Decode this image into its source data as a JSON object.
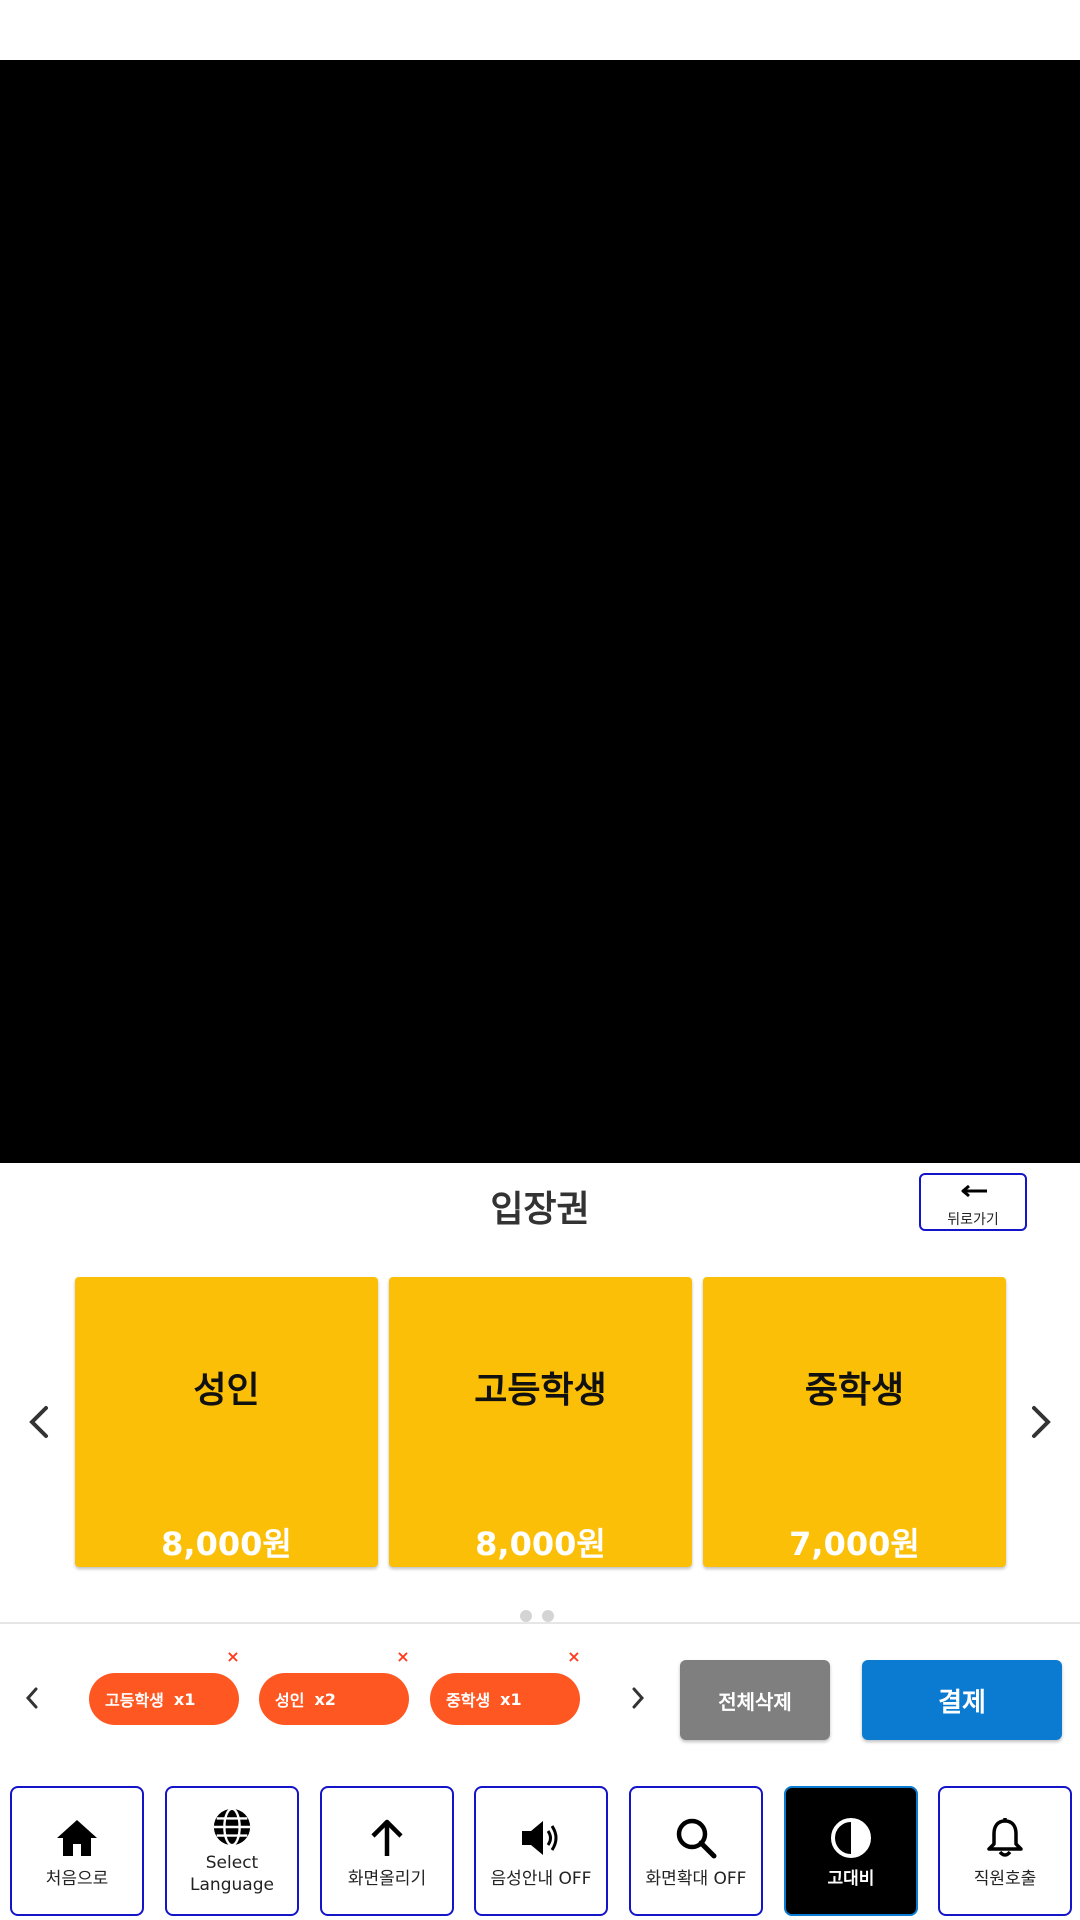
{
  "section": {
    "title": "입장권"
  },
  "back_button": {
    "label": "뒤로가기"
  },
  "tickets": [
    {
      "name": "성인",
      "price": "8,000원"
    },
    {
      "name": "고등학생",
      "price": "8,000원"
    },
    {
      "name": "중학생",
      "price": "7,000원"
    }
  ],
  "ticket_pager": {
    "pages": 2
  },
  "cart": {
    "items": [
      {
        "name": "고등학생",
        "qty": "x1"
      },
      {
        "name": "성인",
        "qty": "x2"
      },
      {
        "name": "중학생",
        "qty": "x1"
      }
    ],
    "remove_symbol": "×"
  },
  "actions": {
    "clear_all_label": "전체삭제",
    "pay_label": "결제"
  },
  "accessibility": {
    "home_label": "처음으로",
    "language_line1": "Select",
    "language_line2": "Language",
    "scroll_up_label": "화면올리기",
    "voice_label": "음성안내 OFF",
    "zoom_label": "화면확대 OFF",
    "contrast_label": "고대비",
    "call_staff_label": "직원호출"
  },
  "colors": {
    "ticket_card": "#fbbf07",
    "cart_chip": "#ff5722",
    "pay_button": "#0a7bd0",
    "clear_button": "#7f7f7f",
    "button_border": "#1414c8"
  },
  "icons": {
    "back": "back-arrow-icon",
    "ticket_prev": "chevron-left-icon",
    "ticket_next": "chevron-right-icon",
    "home": "home-icon",
    "language": "globe-icon",
    "scroll_up": "arrow-up-icon",
    "voice": "speaker-icon",
    "zoom": "magnifier-icon",
    "contrast": "contrast-icon",
    "call_staff": "bell-icon"
  }
}
